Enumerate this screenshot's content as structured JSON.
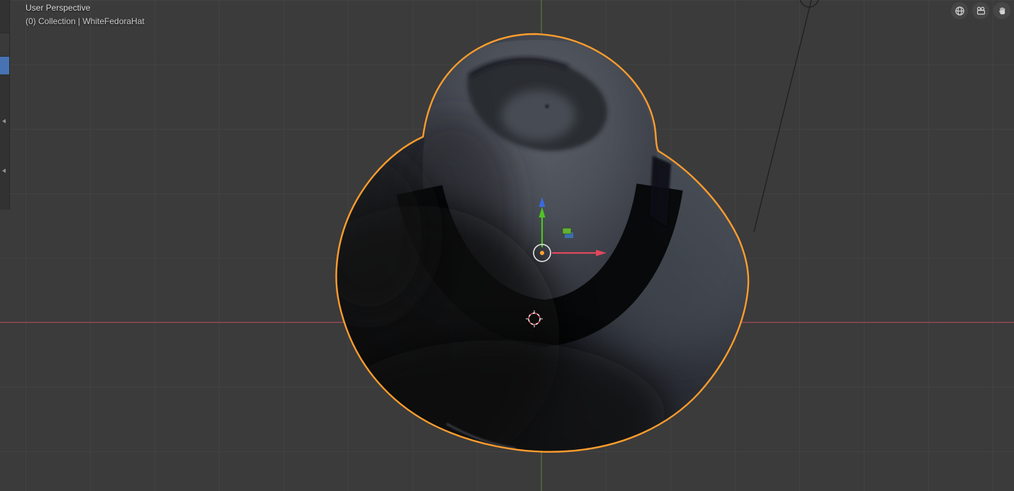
{
  "header": {
    "view_label": "User Perspective",
    "collection_breadcrumb": "(0) Collection | WhiteFedoraHat"
  },
  "scene": {
    "selected_object": "WhiteFedoraHat",
    "selected": true,
    "gizmo": "move",
    "markers": [
      "origin-gizmo",
      "3d-cursor",
      "object-data-icon",
      "light-wire"
    ]
  },
  "nav": {
    "buttons": [
      {
        "id": "ortho-toggle",
        "icon": "grid-sphere-icon"
      },
      {
        "id": "camera-view",
        "icon": "camera-icon"
      },
      {
        "id": "pan-view",
        "icon": "hand-icon"
      }
    ]
  },
  "sidebar": {
    "icons": [
      "active-tool-tab",
      "collapse-arrow",
      "collapse-arrow"
    ]
  },
  "colors": {
    "background": "#3b3b3b",
    "grid": "#454545",
    "axis_x": "#b14b57",
    "axis_y": "#5f7f3a",
    "outline": "#ff9d2d",
    "gizmo_x": "#e0485e",
    "gizmo_y": "#4fc226",
    "gizmo_z": "#3a6ae0",
    "gizmo_center": "#ffa22f",
    "cursor": "#cf4a4e",
    "accent": "#4772b3",
    "text": "#d9d9d9"
  }
}
